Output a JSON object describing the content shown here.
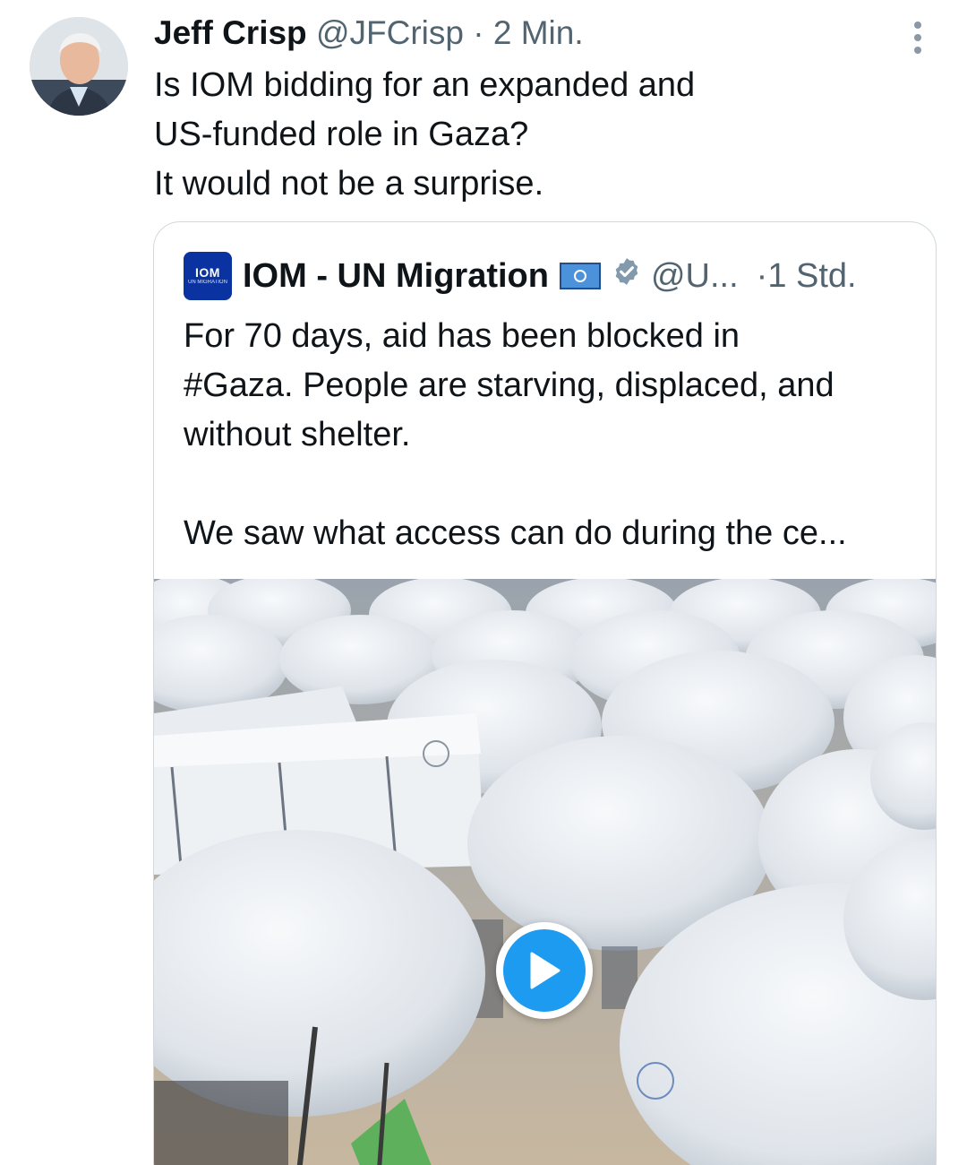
{
  "tweet": {
    "author_name": "Jeff Crisp",
    "author_handle": "@JFCrisp",
    "separator": "·",
    "time": "2 Min.",
    "text_lines": [
      "Is IOM bidding for an expanded and",
      "US-funded role in Gaza?",
      "It would not be a surprise."
    ],
    "more_icon": "more-vertical-icon"
  },
  "quote": {
    "avatar_logo_text": "IOM",
    "avatar_logo_subtext": "UN MIGRATION",
    "name": "IOM - UN Migration",
    "flag_icon": "un-flag-icon",
    "verified_icon": "verified-badge-icon",
    "handle": "@U...",
    "time": "·1 Std.",
    "text_lines": [
      "For 70 days, aid has been blocked in",
      "#Gaza. People are starving, displaced, and",
      "without shelter.",
      "",
      "We saw what access can do during the ce..."
    ],
    "media": {
      "type": "video",
      "play_icon": "play-icon"
    }
  },
  "colors": {
    "text": "#0f1419",
    "secondary": "#536471",
    "accent": "#1d9bf0",
    "border": "#cfd9de",
    "iom_blue": "#0a33a1"
  }
}
